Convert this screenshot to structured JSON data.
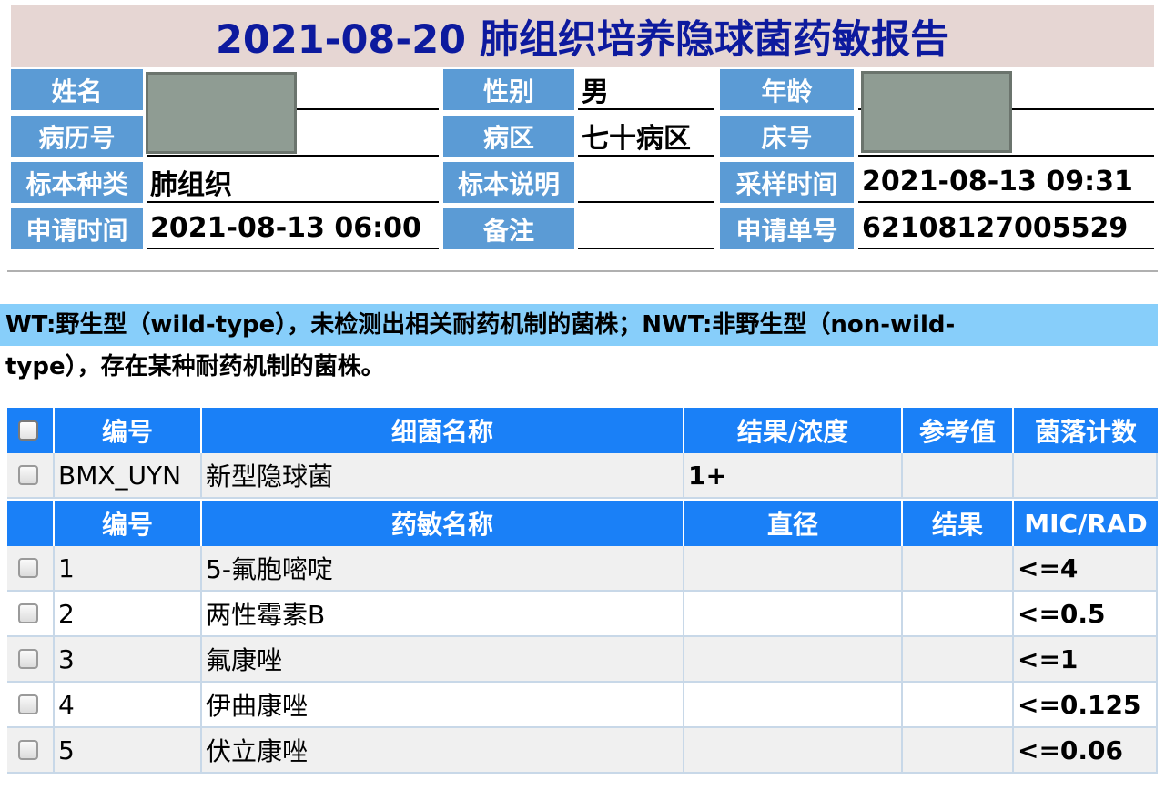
{
  "title": "2021-08-20 肺组织培养隐球菌药敏报告",
  "patient": {
    "name_label": "姓名",
    "name_value": "",
    "gender_label": "性别",
    "gender_value": "男",
    "age_label": "年龄",
    "age_value": "",
    "record_label": "病历号",
    "record_value": "",
    "ward_label": "病区",
    "ward_value": "七十病区",
    "bed_label": "床号",
    "bed_value": "",
    "specimen_type_label": "标本种类",
    "specimen_type_value": "肺组织",
    "specimen_note_label": "标本说明",
    "specimen_note_value": "",
    "sample_time_label": "采样时间",
    "sample_time_value": "2021-08-13 09:31",
    "request_time_label": "申请时间",
    "request_time_value": "2021-08-13 06:00",
    "remark_label": "备注",
    "remark_value": "",
    "request_no_label": "申请单号",
    "request_no_value": "62108127005529"
  },
  "legend": {
    "line1": "WT:野生型（wild-type），未检测出相关耐药机制的菌株；NWT:非野生型（non-wild-",
    "line2": "type），存在某种耐药机制的菌株。"
  },
  "bacteria_header": [
    "编号",
    "细菌名称",
    "结果/浓度",
    "参考值",
    "菌落计数"
  ],
  "bacteria_rows": [
    {
      "id": "BMX_UYN",
      "name": "新型隐球菌",
      "result": "1+",
      "reference": "",
      "count": ""
    }
  ],
  "drug_header": [
    "编号",
    "药敏名称",
    "直径",
    "结果",
    "MIC/RAD"
  ],
  "drug_rows": [
    {
      "id": "1",
      "name": "5-氟胞嘧啶",
      "diameter": "",
      "result": "",
      "mic": "<=4"
    },
    {
      "id": "2",
      "name": "两性霉素B",
      "diameter": "",
      "result": "",
      "mic": "<=0.5"
    },
    {
      "id": "3",
      "name": "氟康唑",
      "diameter": "",
      "result": "",
      "mic": "<=1"
    },
    {
      "id": "4",
      "name": "伊曲康唑",
      "diameter": "",
      "result": "",
      "mic": "<=0.125"
    },
    {
      "id": "5",
      "name": "伏立康唑",
      "diameter": "",
      "result": "",
      "mic": "<=0.06"
    }
  ]
}
